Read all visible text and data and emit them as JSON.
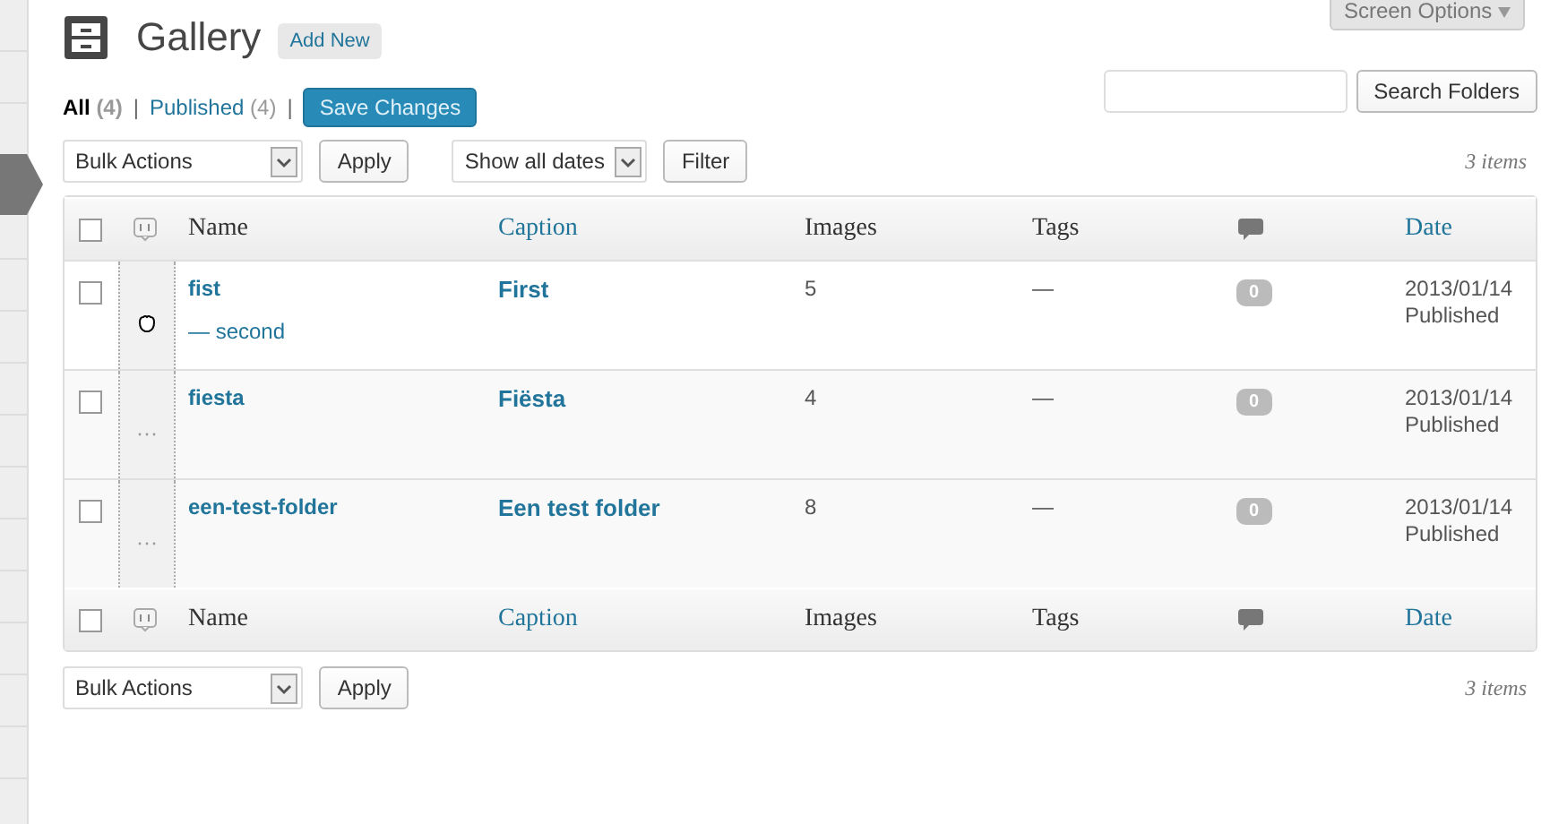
{
  "screen_options": "Screen Options",
  "title": "Gallery",
  "add_new": "Add New",
  "views": [
    {
      "label": "All",
      "count": "(4)",
      "selected": true,
      "separator": "|"
    },
    {
      "label": "Published",
      "count": "(4)",
      "selected": false,
      "separator": "|"
    }
  ],
  "save_changes": "Save Changes",
  "search": {
    "button": "Search Folders"
  },
  "top_actions": {
    "bulk": "Bulk Actions",
    "apply": "Apply",
    "dates": "Show all dates",
    "filter": "Filter",
    "count": "3 items"
  },
  "header": {
    "checked": false,
    "columns": [
      {
        "label": "Name",
        "sortable": false
      },
      {
        "label": "Caption",
        "sortable": true
      },
      {
        "label": "Images",
        "sortable": false
      },
      {
        "label": "Tags",
        "sortable": false
      },
      {
        "label": "Date",
        "sortable": true
      }
    ]
  },
  "rows": [
    {
      "name": "fist",
      "children": [
        "— second"
      ],
      "caption": "First",
      "images": "5",
      "tags": "—",
      "comments": "0",
      "date": "2013/01/14",
      "status": "Published",
      "checked": false,
      "kind": "grab"
    },
    {
      "name": "fiesta",
      "children": [],
      "caption": "Fiësta",
      "images": "4",
      "tags": "—",
      "comments": "0",
      "date": "2013/01/14",
      "status": "Published",
      "checked": false,
      "kind": "dots"
    },
    {
      "name": "een-test-folder",
      "children": [],
      "caption": "Een test folder",
      "images": "8",
      "tags": "—",
      "comments": "0",
      "date": "2013/01/14",
      "status": "Published",
      "checked": false,
      "kind": "dots"
    }
  ],
  "footer": {
    "checked": false,
    "columns": [
      {
        "label": "Name",
        "sortable": false
      },
      {
        "label": "Caption",
        "sortable": true
      },
      {
        "label": "Images",
        "sortable": false
      },
      {
        "label": "Tags",
        "sortable": false
      },
      {
        "label": "Date",
        "sortable": true
      }
    ]
  },
  "bottom_actions": {
    "bulk": "Bulk Actions",
    "apply": "Apply",
    "count": "3 items"
  }
}
